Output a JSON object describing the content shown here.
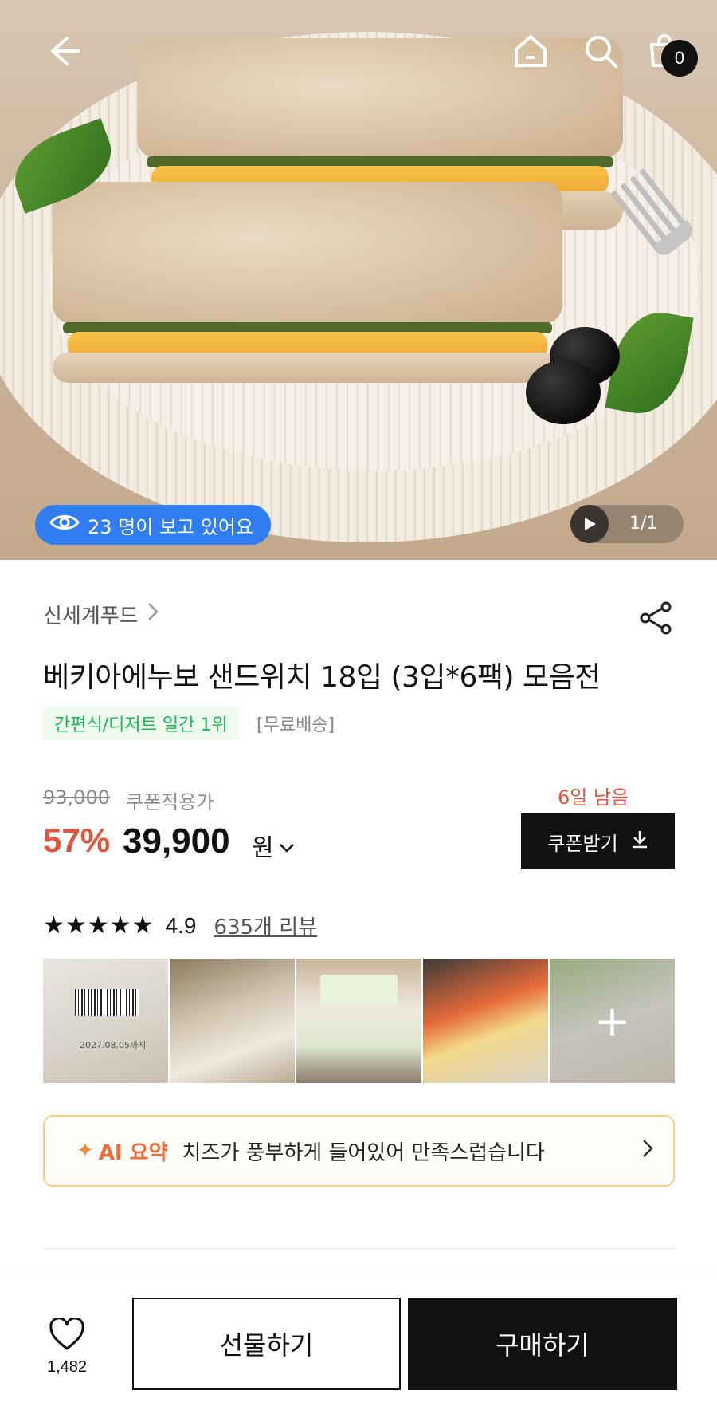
{
  "hero": {
    "viewing_text": "23 명이 보고 있어요",
    "pager": "1/1",
    "cart_count": "0"
  },
  "product": {
    "brand": "신세계푸드",
    "title": "베키아에누보 샌드위치 18입 (3입*6팩) 모음전",
    "rank_badge": "간편식/디저트 일간 1위",
    "shipping": "[무료배송]"
  },
  "price": {
    "original": "93,000",
    "coupon_label": "쿠폰적용가",
    "days_left": "6일 남음",
    "discount": "57%",
    "amount": "39,900",
    "currency": "원",
    "coupon_button": "쿠폰받기"
  },
  "reviews": {
    "stars": "★★★★★",
    "score": "4.9",
    "count_link": "635개 리뷰",
    "photo_date": "2027.08.05까지",
    "more_symbol": "+"
  },
  "ai_summary": {
    "label": "AI 요약",
    "text": "치즈가 풍부하게 들어있어 만족스럽습니다"
  },
  "bottom_bar": {
    "wish_count": "1,482",
    "gift_label": "선물하기",
    "buy_label": "구매하기"
  },
  "colors": {
    "accent_red": "#e0553d",
    "badge_blue": "#2f7df0",
    "rank_green": "#1db954",
    "ai_orange": "#f06a3a"
  }
}
